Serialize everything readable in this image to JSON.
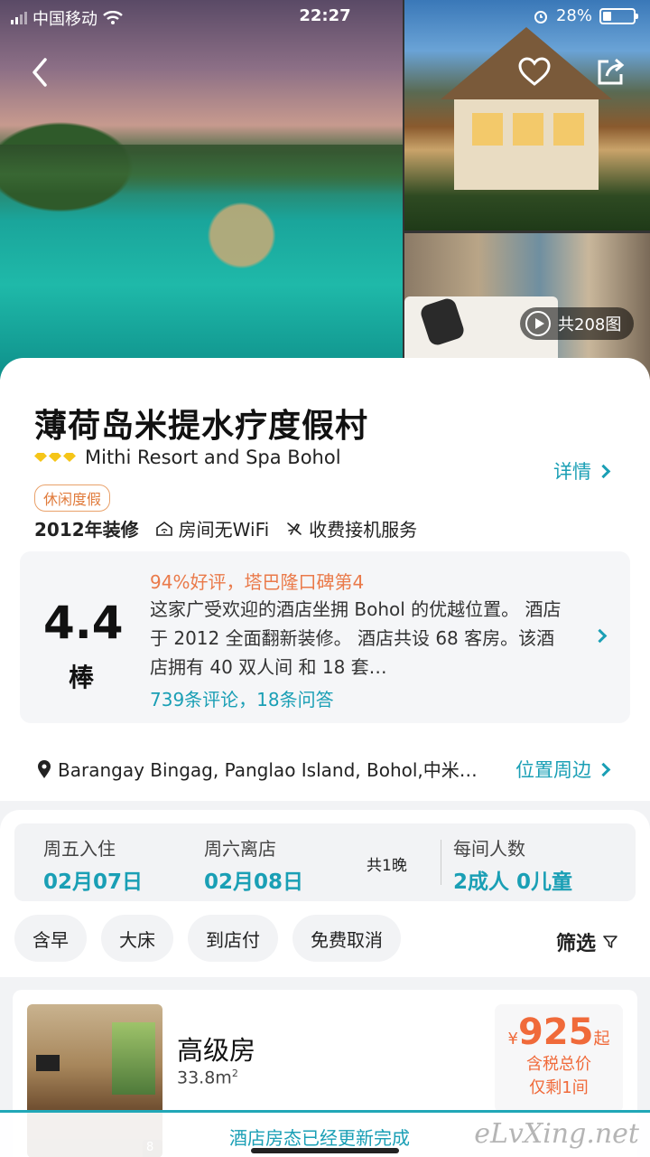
{
  "status_bar": {
    "carrier": "中国移动",
    "time": "22:27",
    "battery": "28%"
  },
  "hero": {
    "photo_count": "共208图"
  },
  "hotel": {
    "name": "薄荷岛米提水疗度假村",
    "name_en": "Mithi Resort and Spa Bohol",
    "details_label": "详情",
    "tag": "休闲度假",
    "renovated": "2012年装修",
    "wifi": "房间无WiFi",
    "airport": "收费接机服务"
  },
  "review": {
    "score": "4.4",
    "score_word": "棒",
    "highlight": "94%好评，塔巴隆口碑第4",
    "text": "这家广受欢迎的酒店坐拥 Bohol 的优越位置。 酒店 于 2012 全面翻新装修。 酒店共设 68 客房。该酒店拥有 40 双人间 和 18 套…",
    "count": "739条评论，18条问答"
  },
  "location": {
    "address": "Barangay Bingag, Panglao Island, Bohol,中米…",
    "nearby_label": "位置周边"
  },
  "booking": {
    "checkin_label": "周五入住",
    "checkin_date": "02月07日",
    "checkout_label": "周六离店",
    "checkout_date": "02月08日",
    "nights": "共1晚",
    "guests_label": "每间人数",
    "guests_value": "2成人 0儿童"
  },
  "filters": {
    "chips": [
      "含早",
      "大床",
      "到店付",
      "免费取消"
    ],
    "filter_label": "筛选"
  },
  "room": {
    "name": "高级房",
    "size": "33.8m",
    "size_unit_sup": "2",
    "photo_count": "8张",
    "price_currency": "¥",
    "price": "925",
    "price_suffix": "起",
    "price_note1": "含税总价",
    "price_note2": "仅剩1间"
  },
  "toast": {
    "text": "酒店房态已经更新完成",
    "watermark": "eLvXing.net"
  },
  "colors": {
    "accent": "#1a9fb5",
    "price": "#f06a3a",
    "highlight": "#ea7a4a"
  }
}
